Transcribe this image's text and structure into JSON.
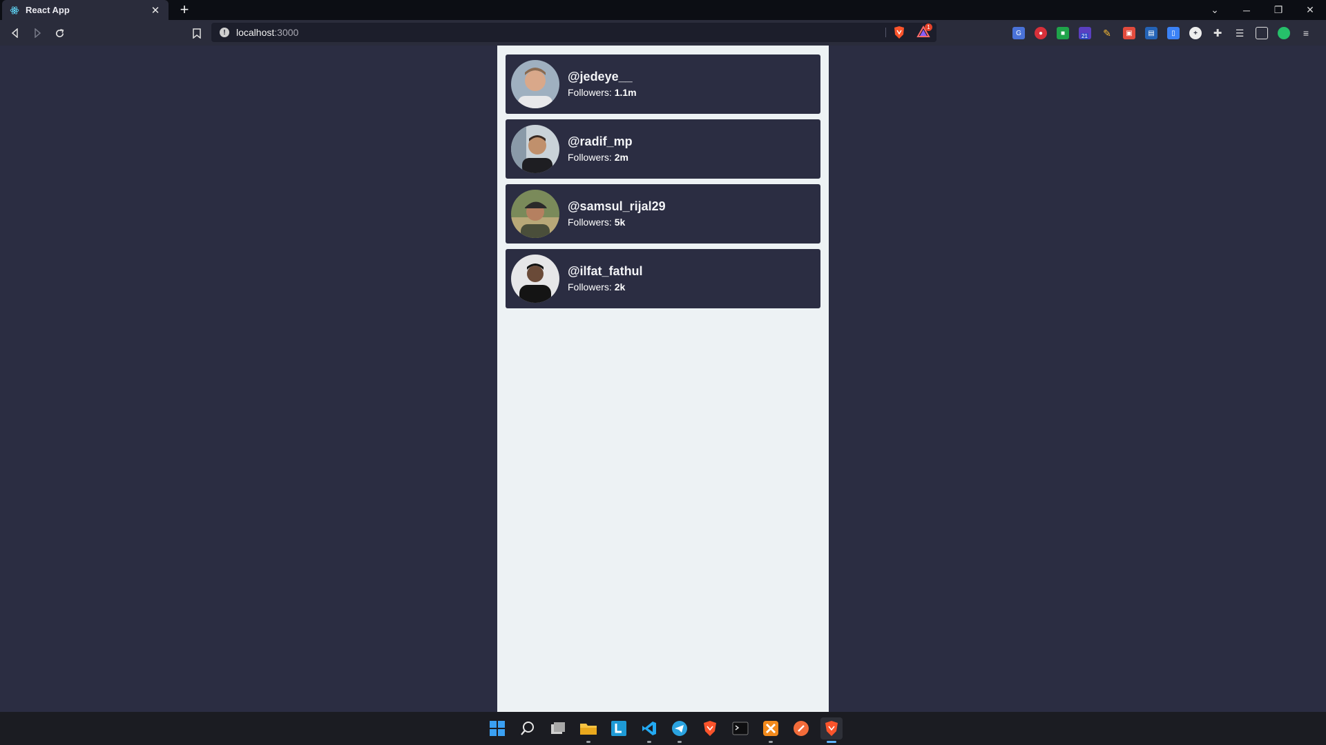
{
  "browser": {
    "tab_title": "React App",
    "url_host": "localhost",
    "url_port": ":3000",
    "shield_badge": "1",
    "ext_badge": "21"
  },
  "profiles": [
    {
      "username": "@jedeye__",
      "followers_label": "Followers:",
      "followers": "1.1m"
    },
    {
      "username": "@radif_mp",
      "followers_label": "Followers:",
      "followers": "2m"
    },
    {
      "username": "@samsul_rijal29",
      "followers_label": "Followers:",
      "followers": "5k"
    },
    {
      "username": "@ilfat_fathul",
      "followers_label": "Followers:",
      "followers": "2k"
    }
  ],
  "colors": {
    "page_bg": "#2b2d42",
    "column_bg": "#edf2f4",
    "card_bg": "#2b2d42",
    "text": "#ffffff"
  },
  "taskbar": {
    "icons": [
      "windows-start-icon",
      "search-icon",
      "task-view-icon",
      "file-explorer-icon",
      "lockbox-icon",
      "vscode-icon",
      "telegram-icon",
      "brave-icon",
      "terminal-icon",
      "xampp-icon",
      "postman-icon",
      "brave-active-icon"
    ]
  }
}
